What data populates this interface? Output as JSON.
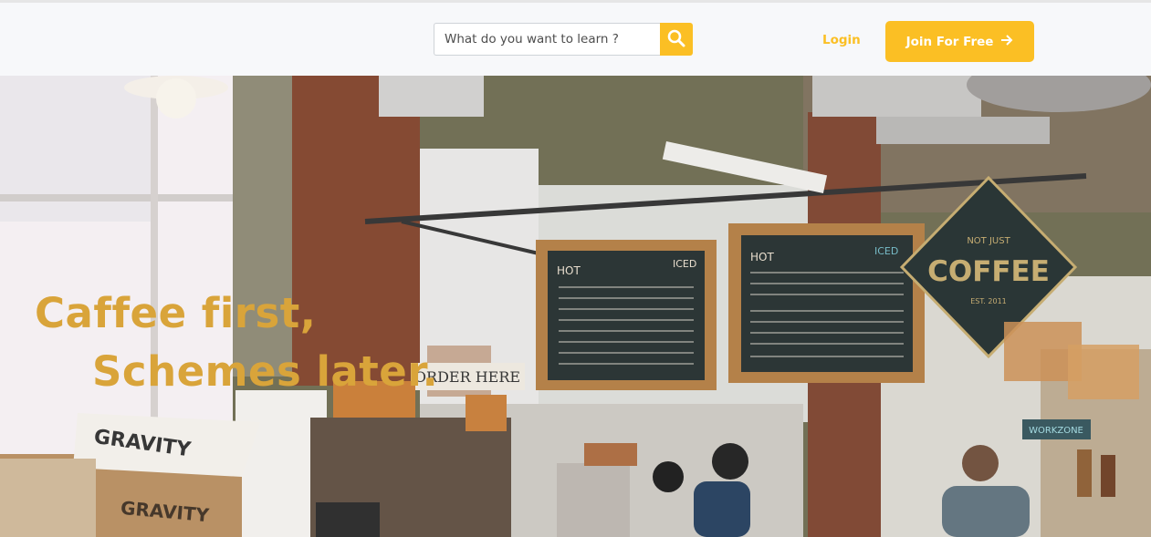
{
  "header": {
    "search": {
      "placeholder": "What do you want to learn ?"
    },
    "search_button_icon": "search-icon",
    "login_label": "Login",
    "join_label": "Join For Free",
    "join_icon": "arrow-right-icon"
  },
  "hero": {
    "tagline_line1": "Caffee first,",
    "tagline_line2": "Schemes later.",
    "signs": {
      "menu_left_hot": "HOT",
      "menu_left_iced": "ICED",
      "menu_right_hot": "HOT",
      "menu_right_iced": "ICED",
      "coffee_sign_top": "NOT JUST",
      "coffee_sign_main": "COFFEE",
      "coffee_sign_est": "EST. 2011",
      "order_sign": "ORDER HERE",
      "box_label_1": "GRAVITY",
      "box_label_2": "GRAVITY",
      "workzone_sign": "WORKZONE"
    }
  },
  "colors": {
    "accent": "#fbbf24",
    "tagline": "#d9a43a",
    "header_bg": "#f7f8fa"
  }
}
